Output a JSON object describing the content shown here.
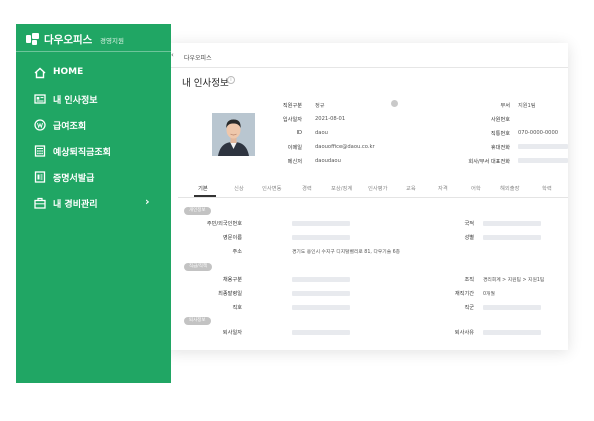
{
  "sidebar": {
    "brand_name": "다우오피스",
    "brand_sub": "경영지원",
    "items": [
      {
        "label": "HOME",
        "icon": "home-icon"
      },
      {
        "label": "내 인사정보",
        "icon": "id-card-icon"
      },
      {
        "label": "급여조회",
        "icon": "won-coin-icon"
      },
      {
        "label": "예상퇴직금조회",
        "icon": "calculator-icon"
      },
      {
        "label": "증명서발급",
        "icon": "certificate-icon"
      },
      {
        "label": "내 경비관리",
        "icon": "briefcase-icon",
        "has_submenu": true
      }
    ]
  },
  "breadcrumb": "다우오피스",
  "page_title": "내 인사정보",
  "profile": {
    "left": [
      {
        "label": "직원구분",
        "value": "정규"
      },
      {
        "label": "입사일자",
        "value": "2021-08-01"
      },
      {
        "label": "ID",
        "value": "daou"
      },
      {
        "label": "이메일",
        "value": "daouoffice@daou.co.kr"
      },
      {
        "label": "메신저",
        "value": "daoudaou"
      }
    ],
    "right": [
      {
        "label": "부서",
        "value": "지원1팀"
      },
      {
        "label": "사원번호",
        "value": ""
      },
      {
        "label": "직통번호",
        "value": "070-0000-0000"
      },
      {
        "label": "휴대전화",
        "value": ""
      },
      {
        "label": "회사/부서 대표전화",
        "value": ""
      }
    ]
  },
  "tabs": [
    "기본",
    "신상",
    "인사변동",
    "경력",
    "포상/징계",
    "인사평가",
    "교육",
    "자격",
    "어학",
    "해외출장",
    "학력"
  ],
  "sections": [
    {
      "badge": "개인정보",
      "fields": [
        {
          "label": "주민/외국인번호",
          "value": ""
        },
        {
          "label": "영문이름",
          "value": ""
        },
        {
          "label": "주소",
          "value": "경기도 용인시 수지구 디지털벨리로 81, 다우기술 6층"
        }
      ],
      "right_fields": [
        {
          "label": "국적",
          "value": ""
        },
        {
          "label": "성별",
          "value": ""
        }
      ]
    },
    {
      "badge": "직급/직책",
      "fields": [
        {
          "label": "채용구분",
          "value": ""
        },
        {
          "label": "최종발령일",
          "value": ""
        },
        {
          "label": "직호",
          "value": ""
        }
      ],
      "right_fields": [
        {
          "label": "조직",
          "value": "경리회계 > 지원팀 > 지원1팀"
        },
        {
          "label": "재직기간",
          "value": "0개월"
        },
        {
          "label": "직군",
          "value": ""
        }
      ]
    },
    {
      "badge": "퇴사정보",
      "fields": [
        {
          "label": "퇴사일자",
          "value": ""
        }
      ],
      "right_fields": [
        {
          "label": "퇴사사유",
          "value": ""
        }
      ]
    }
  ],
  "colors": {
    "sidebar": "#20a664",
    "badge": "#c3c3c3"
  }
}
